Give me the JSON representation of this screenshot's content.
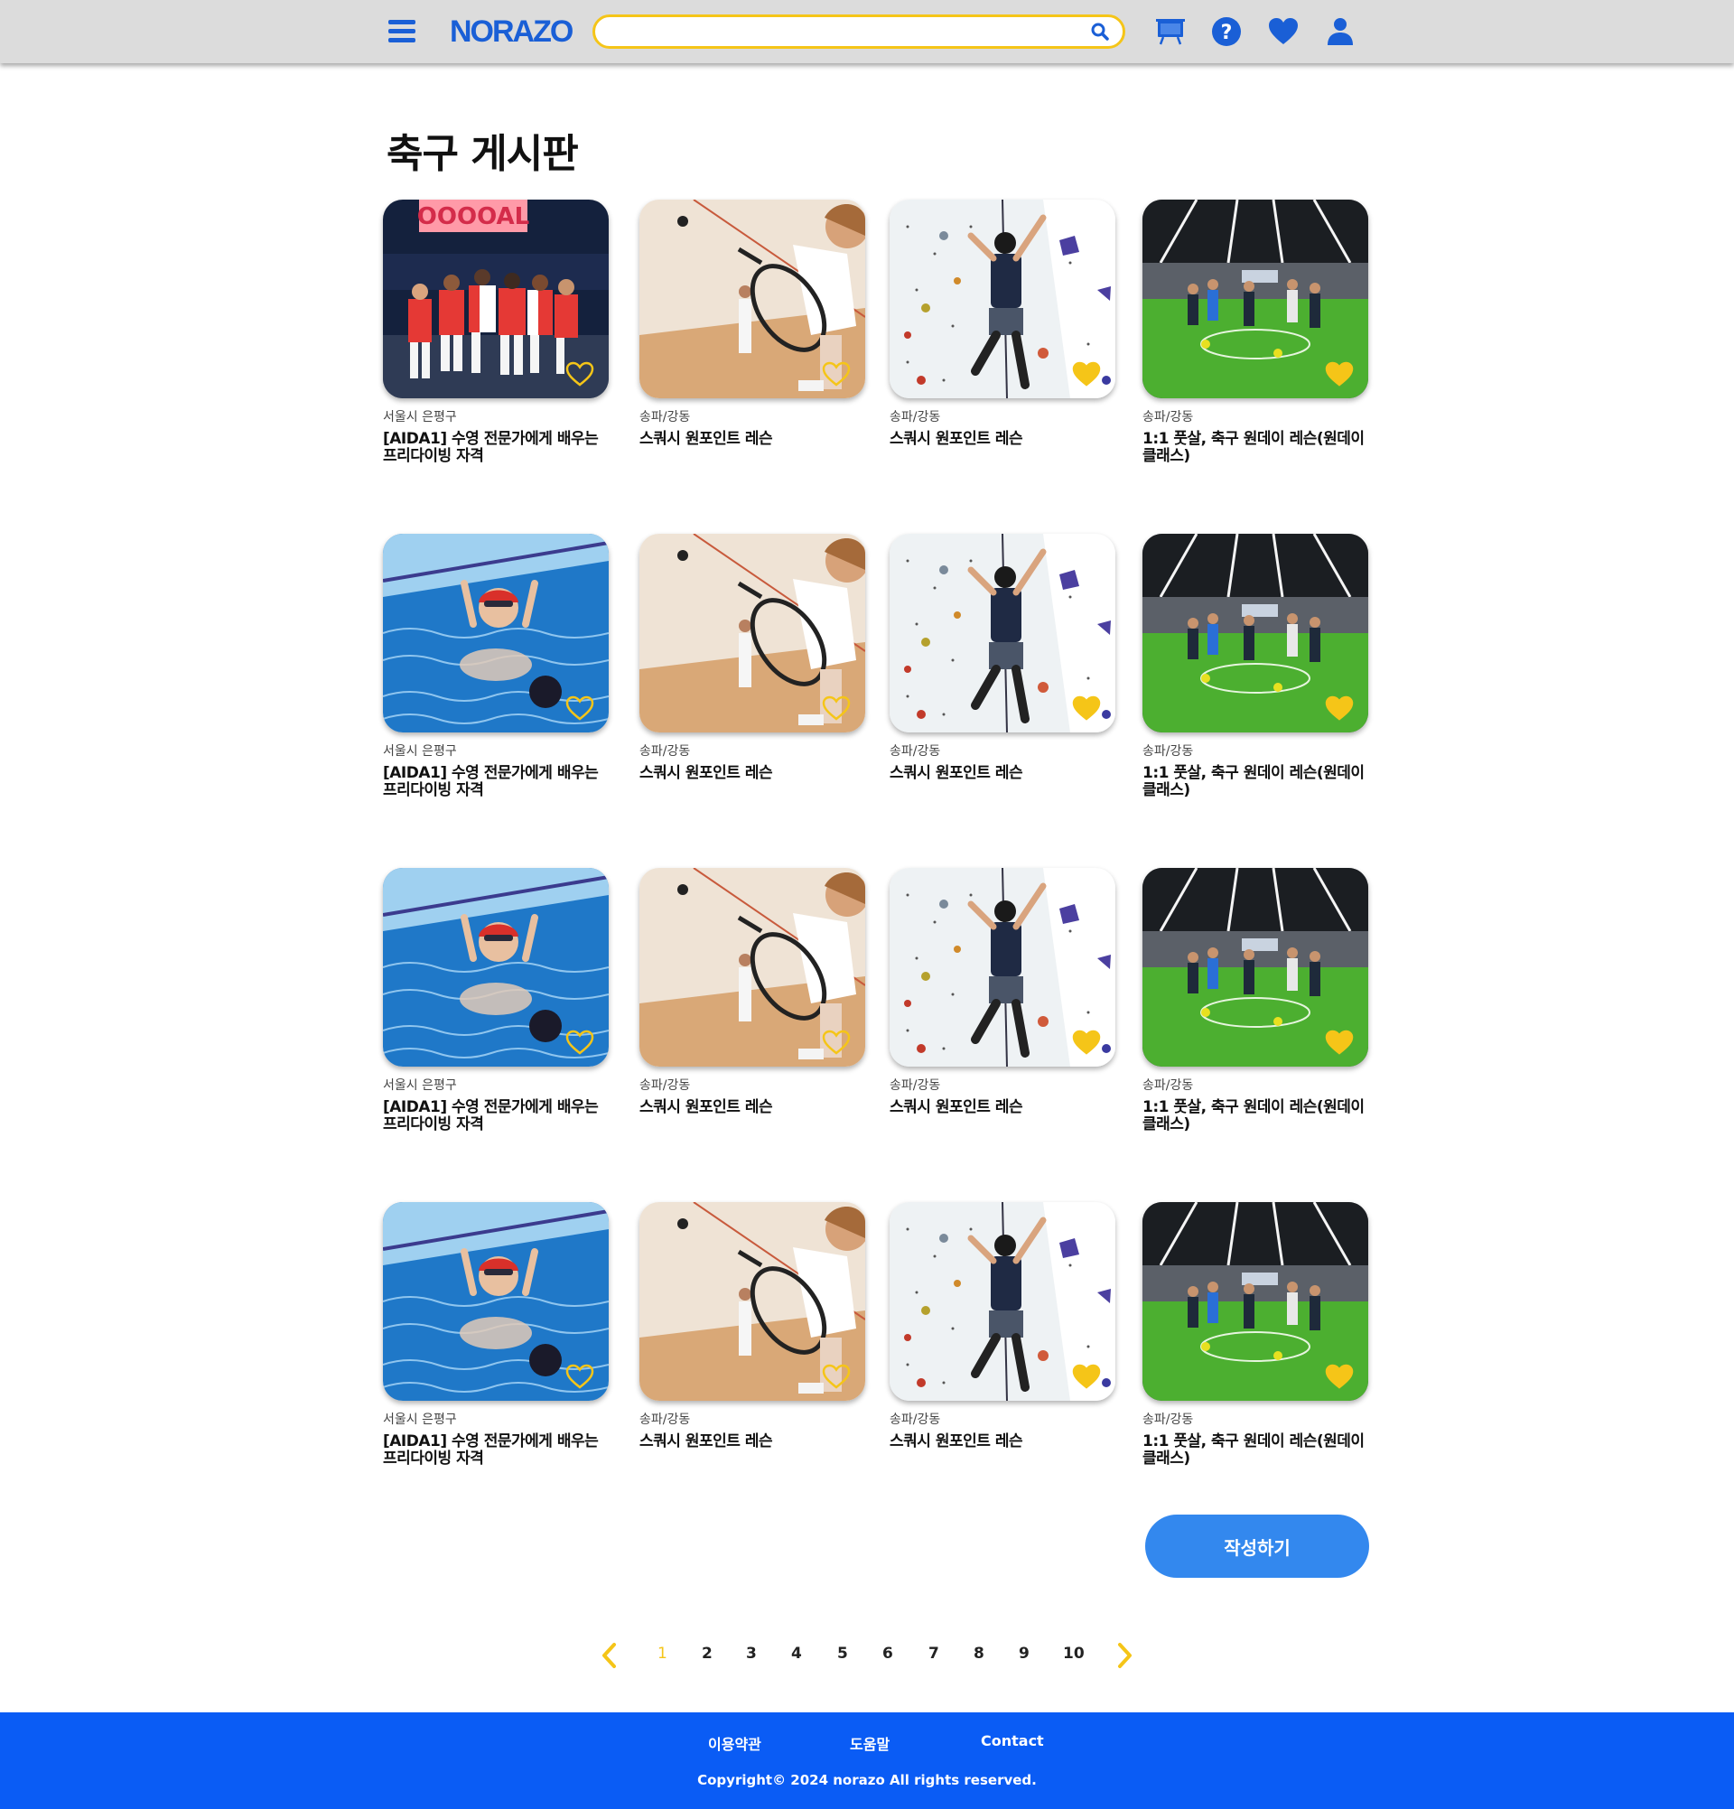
{
  "header": {
    "logo": "NORAZO",
    "search_placeholder": "",
    "accent_color": "#1a5fd6",
    "search_border_color": "#f5c518",
    "icons": [
      "menu-icon",
      "search-icon",
      "board-icon",
      "help-icon",
      "heart-icon",
      "user-icon"
    ]
  },
  "page_title": "축구 게시판",
  "cards": [
    {
      "location": "서울시 은평구",
      "title": "[AIDA1] 수영 전문가에게 배우는 프리다이빙 자격",
      "image": "football-celebration",
      "liked": false
    },
    {
      "location": "송파/강동",
      "title": "스쿼시 원포인트 레슨",
      "image": "squash",
      "liked": false
    },
    {
      "location": "송파/강동",
      "title": "스쿼시 원포인트 레슨",
      "image": "climbing",
      "liked": true
    },
    {
      "location": "송파/강동",
      "title": "1:1 풋살, 축구 원데이 레슨(원데이 클래스)",
      "image": "futsal",
      "liked": true
    },
    {
      "location": "서울시 은평구",
      "title": "[AIDA1] 수영 전문가에게 배우는 프리다이빙 자격",
      "image": "swimming",
      "liked": false
    },
    {
      "location": "송파/강동",
      "title": "스쿼시 원포인트 레슨",
      "image": "squash",
      "liked": false
    },
    {
      "location": "송파/강동",
      "title": "스쿼시 원포인트 레슨",
      "image": "climbing",
      "liked": true
    },
    {
      "location": "송파/강동",
      "title": "1:1 풋살, 축구 원데이 레슨(원데이 클래스)",
      "image": "futsal",
      "liked": true
    },
    {
      "location": "서울시 은평구",
      "title": "[AIDA1] 수영 전문가에게 배우는 프리다이빙 자격",
      "image": "swimming",
      "liked": false
    },
    {
      "location": "송파/강동",
      "title": "스쿼시 원포인트 레슨",
      "image": "squash",
      "liked": false
    },
    {
      "location": "송파/강동",
      "title": "스쿼시 원포인트 레슨",
      "image": "climbing",
      "liked": true
    },
    {
      "location": "송파/강동",
      "title": "1:1 풋살, 축구 원데이 레슨(원데이 클래스)",
      "image": "futsal",
      "liked": true
    },
    {
      "location": "서울시 은평구",
      "title": "[AIDA1] 수영 전문가에게 배우는 프리다이빙 자격",
      "image": "swimming",
      "liked": false
    },
    {
      "location": "송파/강동",
      "title": "스쿼시 원포인트 레슨",
      "image": "squash",
      "liked": false
    },
    {
      "location": "송파/강동",
      "title": "스쿼시 원포인트 레슨",
      "image": "climbing",
      "liked": true
    },
    {
      "location": "송파/강동",
      "title": "1:1 풋살, 축구 원데이 레슨(원데이 클래스)",
      "image": "futsal",
      "liked": true
    }
  ],
  "write_button": "작성하기",
  "pagination": {
    "pages": [
      "1",
      "2",
      "3",
      "4",
      "5",
      "6",
      "7",
      "8",
      "9",
      "10"
    ],
    "current": "1",
    "prev_icon": "chevron-left-icon",
    "next_icon": "chevron-right-icon"
  },
  "footer": {
    "links": [
      "이용약관",
      "도움말",
      "Contact"
    ],
    "copyright": "Copyright© 2024 norazo All rights reserved.",
    "background": "#0a5cf5"
  }
}
